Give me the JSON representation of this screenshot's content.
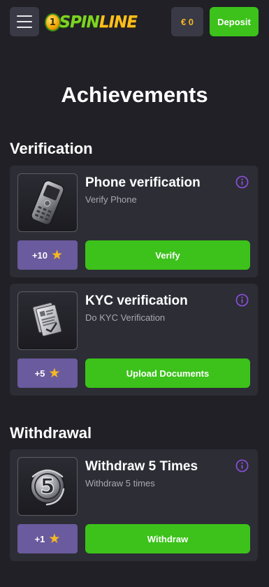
{
  "header": {
    "logo_digit": "1",
    "logo_spin": "SPIN",
    "logo_line": "LINE",
    "balance": "€ 0",
    "deposit_label": "Deposit"
  },
  "page": {
    "title": "Achievements"
  },
  "sections": [
    {
      "title": "Verification",
      "cards": [
        {
          "title": "Phone verification",
          "subtitle": "Verify Phone",
          "points": "+10",
          "action_label": "Verify",
          "image": "phone-icon"
        },
        {
          "title": "KYC verification",
          "subtitle": "Do KYC Verification",
          "points": "+5",
          "action_label": "Upload Documents",
          "image": "document-icon"
        }
      ]
    },
    {
      "title": "Withdrawal",
      "cards": [
        {
          "title": "Withdraw 5 Times",
          "subtitle": "Withdraw 5 times",
          "points": "+1",
          "action_label": "Withdraw",
          "image": "number-five-badge-icon",
          "badge_text": "5"
        }
      ]
    }
  ],
  "colors": {
    "background": "#202026",
    "card": "#2d2d36",
    "accent_green": "#3cc21a",
    "points_purple": "#6a5a9e",
    "info_purple": "#8a4fd8",
    "star_gold": "#f5b823"
  }
}
